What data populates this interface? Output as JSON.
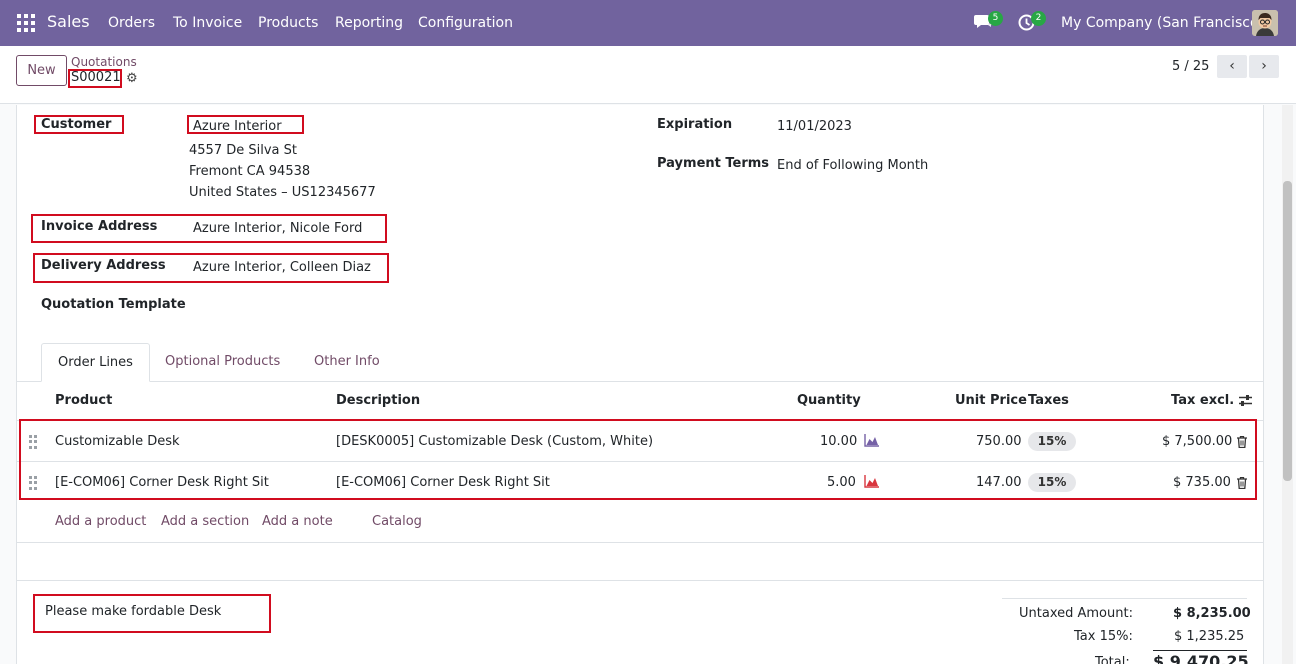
{
  "app": {
    "name": "Sales",
    "menu": [
      "Orders",
      "To Invoice",
      "Products",
      "Reporting",
      "Configuration"
    ],
    "messages_count": "5",
    "activities_count": "2",
    "company": "My Company (San Francisco)"
  },
  "control": {
    "new_label": "New",
    "breadcrumb_parent": "Quotations",
    "breadcrumb_current": "S00021",
    "pager": "5 / 25"
  },
  "form": {
    "customer_label": "Customer",
    "customer_name": "Azure Interior",
    "address_line1": "4557 De Silva St",
    "address_line2": "Fremont CA 94538",
    "address_line3": "United States – US12345677",
    "invoice_label": "Invoice Address",
    "invoice_value": "Azure Interior, Nicole Ford",
    "delivery_label": "Delivery Address",
    "delivery_value": "Azure Interior, Colleen Diaz",
    "template_label": "Quotation Template",
    "expiration_label": "Expiration",
    "expiration_value": "11/01/2023",
    "payment_label": "Payment Terms",
    "payment_value": "End of Following Month"
  },
  "tabs": [
    "Order Lines",
    "Optional Products",
    "Other Info"
  ],
  "table": {
    "headers": {
      "product": "Product",
      "description": "Description",
      "quantity": "Quantity",
      "unit_price": "Unit Price",
      "taxes": "Taxes",
      "tax_excl": "Tax excl."
    },
    "rows": [
      {
        "product": "Customizable Desk",
        "description": "[DESK0005] Customizable Desk (Custom, White)",
        "quantity": "10.00",
        "unit_price": "750.00",
        "tax": "15%",
        "subtotal": "$ 7,500.00",
        "forecast_color": "#7561a6"
      },
      {
        "product": "[E-COM06] Corner Desk Right Sit",
        "description": "[E-COM06] Corner Desk Right Sit",
        "quantity": "5.00",
        "unit_price": "147.00",
        "tax": "15%",
        "subtotal": "$ 735.00",
        "forecast_color": "#d9363e"
      }
    ],
    "add_links": [
      "Add a product",
      "Add a section",
      "Add a note",
      "Catalog"
    ]
  },
  "note": "Please make fordable Desk",
  "totals": {
    "untaxed_label": "Untaxed Amount:",
    "untaxed_value": "$ 8,235.00",
    "tax_label": "Tax 15%:",
    "tax_value": "$ 1,235.25",
    "total_label": "Total:",
    "total_value": "$ 9,470.25"
  },
  "colors": {
    "navbar": "#71639e",
    "accent": "#714b67",
    "highlight_box": "#d10c1f",
    "badge": "#28a745"
  }
}
